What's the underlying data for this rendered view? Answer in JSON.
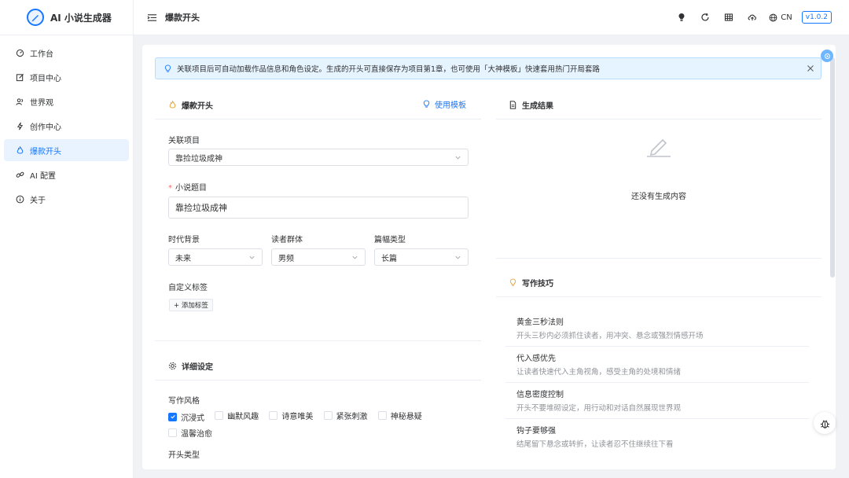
{
  "app": {
    "title": "AI 小说生成器"
  },
  "sidebar": {
    "items": [
      {
        "label": "工作台",
        "icon": "dashboard-icon"
      },
      {
        "label": "项目中心",
        "icon": "edit-icon"
      },
      {
        "label": "世界观",
        "icon": "people-icon"
      },
      {
        "label": "创作中心",
        "icon": "lightning-icon"
      },
      {
        "label": "爆款开头",
        "icon": "flame-icon",
        "active": true
      },
      {
        "label": "AI 配置",
        "icon": "link-icon"
      },
      {
        "label": "关于",
        "icon": "info-icon"
      }
    ]
  },
  "header": {
    "title": "爆款开头",
    "lang": "CN",
    "version": "v1.0.2"
  },
  "info": {
    "text": "关联项目后可自动加载作品信息和角色设定。生成的开头可直接保存为项目第1章，也可使用「大神模板」快速套用热门开局套路"
  },
  "form": {
    "section_title": "爆款开头",
    "use_template": "使用模板",
    "project_label": "关联项目",
    "project_value": "靠捡垃圾成神",
    "title_label": "小说题目",
    "title_value": "靠捡垃圾成神",
    "era_label": "时代背景",
    "era_value": "未来",
    "audience_label": "读者群体",
    "audience_value": "男频",
    "length_label": "篇幅类型",
    "length_value": "长篇",
    "tags_label": "自定义标签",
    "add_tag": "+ 添加标签",
    "detail_title": "详细设定",
    "style_label": "写作风格",
    "styles": [
      {
        "label": "沉浸式",
        "checked": true
      },
      {
        "label": "幽默风趣",
        "checked": false
      },
      {
        "label": "诗意唯美",
        "checked": false
      },
      {
        "label": "紧张刺激",
        "checked": false
      },
      {
        "label": "神秘悬疑",
        "checked": false
      },
      {
        "label": "温馨治愈",
        "checked": false
      }
    ],
    "opening_label": "开头类型"
  },
  "result": {
    "title": "生成结果",
    "empty": "还没有生成内容"
  },
  "tips": {
    "title": "写作技巧",
    "items": [
      {
        "title": "黄金三秒法则",
        "desc": "开头三秒内必须抓住读者，用冲突、悬念或强烈情感开场"
      },
      {
        "title": "代入感优先",
        "desc": "让读者快速代入主角视角，感受主角的处境和情绪"
      },
      {
        "title": "信息密度控制",
        "desc": "开头不要堆砌设定，用行动和对话自然展现世界观"
      },
      {
        "title": "钩子要够强",
        "desc": "结尾留下悬念或转折，让读者忍不住继续往下看"
      }
    ]
  },
  "colors": {
    "accent": "#1677ff",
    "info_bg": "#e6f4ff",
    "active_bg": "#e8f3ff"
  }
}
